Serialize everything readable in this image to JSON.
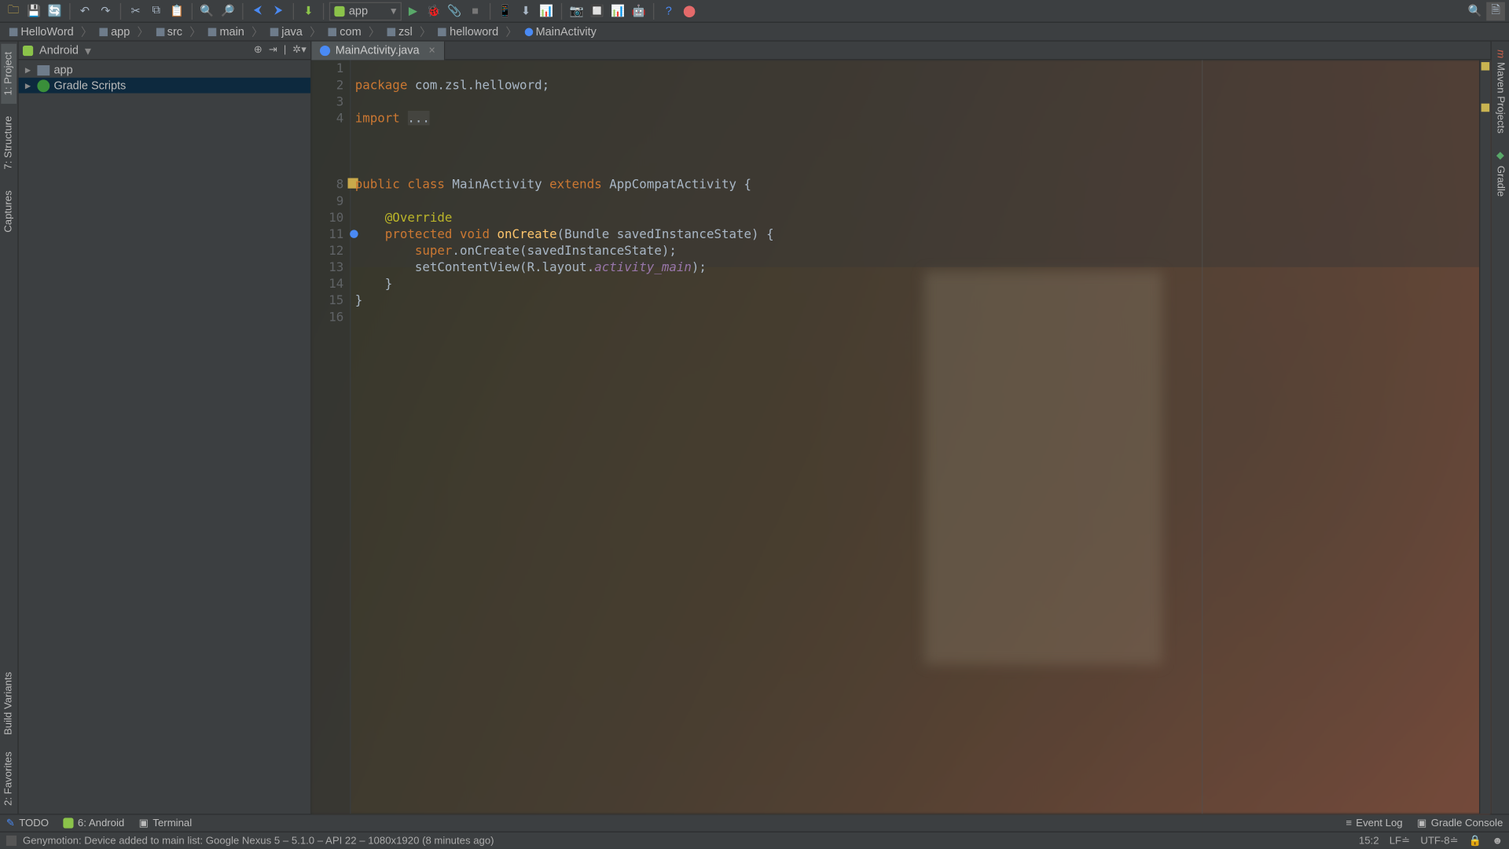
{
  "toolbar": {
    "run_label": "app"
  },
  "breadcrumb": [
    "HelloWord",
    "app",
    "src",
    "main",
    "java",
    "com",
    "zsl",
    "helloword",
    "MainActivity"
  ],
  "left_tabs": {
    "project": "1: Project",
    "structure": "7: Structure",
    "captures": "Captures",
    "build_variants": "Build Variants",
    "favorites": "2: Favorites"
  },
  "right_tabs": {
    "maven": "Maven Projects",
    "gradle": "Gradle"
  },
  "project_panel": {
    "view_label": "Android",
    "tree": {
      "app": "app",
      "gradle": "Gradle Scripts"
    }
  },
  "file_tab": {
    "name": "MainActivity.java"
  },
  "code": {
    "lines": [
      "1",
      "2",
      "3",
      "4",
      "",
      "",
      "",
      "8",
      "9",
      "10",
      "11",
      "12",
      "13",
      "14",
      "15",
      "16"
    ],
    "l1_a": "package ",
    "l1_b": "com.zsl.helloword;",
    "l3_a": "import ",
    "l3_b": "...",
    "l8_a": "public class ",
    "l8_b": "MainActivity ",
    "l8_c": "extends ",
    "l8_d": "AppCompatActivity {",
    "l10": "    @Override",
    "l11_a": "    protected void ",
    "l11_b": "onCreate",
    "l11_c": "(Bundle savedInstanceState) {",
    "l12_a": "        super",
    "l12_b": ".onCreate(savedInstanceState);",
    "l13_a": "        setContentView(R.layout.",
    "l13_b": "activity_main",
    "l13_c": ");",
    "l14": "    }",
    "l15": "}"
  },
  "bottom_tabs": {
    "todo": "TODO",
    "android": "6: Android",
    "terminal": "Terminal",
    "eventlog": "Event Log",
    "gradle_console": "Gradle Console"
  },
  "status": {
    "msg": "Genymotion: Device added to main list: Google Nexus 5 – 5.1.0 – API 22 – 1080x1920 (8 minutes ago)",
    "pos": "15:2",
    "le": "LF≐",
    "enc": "UTF-8≐"
  },
  "icons": {
    "folder": "🗀",
    "save": "💾",
    "sync": "🔄",
    "undo": "↶",
    "redo": "↷",
    "cut": "✂",
    "copy": "⧉",
    "paste": "📋",
    "find": "🔍",
    "replace": "🔎",
    "ctx": "⮌",
    "back": "⮜",
    "fwd": "⮞",
    "make": "⬇",
    "run": "▶",
    "debug": "🐞",
    "stop": "■",
    "attach": "📎",
    "avd": "📱",
    "sdk": "⬇",
    "screenshot": "📷",
    "layout": "🔲",
    "monitor": "📊",
    "adb": "🤖",
    "help": "?",
    "rec": "⬤",
    "search": "🔍",
    "menu": "▤",
    "proj": "🗎"
  }
}
